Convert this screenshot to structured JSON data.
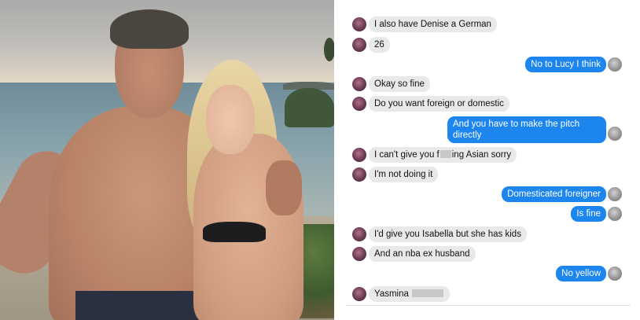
{
  "messages": [
    {
      "from": "them",
      "text": "I also have Denise a German"
    },
    {
      "from": "them",
      "text": "26"
    },
    {
      "from": "me",
      "text": "No to Lucy I think"
    },
    {
      "from": "them",
      "text": "Okay so fine"
    },
    {
      "from": "them",
      "text": "Do you want foreign or domestic"
    },
    {
      "from": "me",
      "text": "And you have to make the pitch directly"
    },
    {
      "from": "them",
      "text_before": "I can't give you f",
      "text_after": "ing Asian sorry"
    },
    {
      "from": "them",
      "text": "I'm not doing it"
    },
    {
      "from": "me",
      "text": "Domesticated foreigner"
    },
    {
      "from": "me",
      "text": "Is fine"
    },
    {
      "from": "them",
      "text": "I'd give you Isabella but she has  kids"
    },
    {
      "from": "them",
      "text": "And an nba ex husband"
    },
    {
      "from": "me",
      "text": "No yellow"
    },
    {
      "from": "them",
      "text": "Yasmina"
    }
  ],
  "colors": {
    "incoming_bubble": "#e9e9eb",
    "outgoing_bubble": "#1c86ee",
    "outgoing_text": "#ffffff"
  }
}
